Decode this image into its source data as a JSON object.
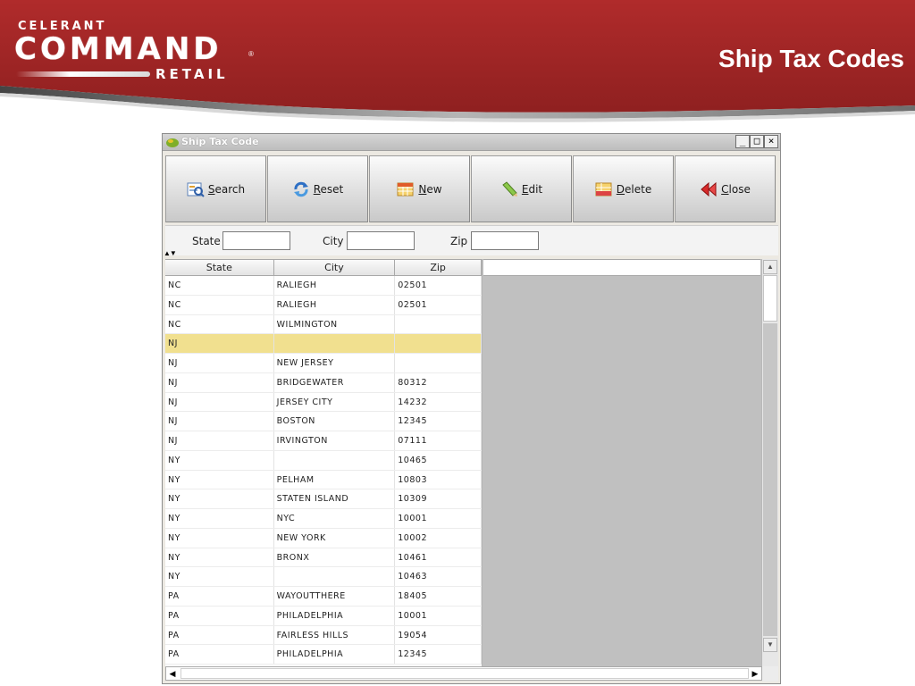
{
  "slide": {
    "title": "Ship Tax Codes",
    "logo_top": "CELERANT",
    "logo_main": "COMMAND",
    "logo_bottom": "RETAIL"
  },
  "window": {
    "title": "Ship Tax Code",
    "controls": {
      "minimize": "_",
      "maximize": "□",
      "close": "×"
    }
  },
  "toolbar": {
    "search_label": "Search",
    "reset_label": "Reset",
    "new_label": "New",
    "edit_label": "Edit",
    "delete_label": "Delete",
    "close_label": "Close"
  },
  "filters": {
    "state_label": "State",
    "city_label": "City",
    "zip_label": "Zip",
    "state_value": "",
    "city_value": "",
    "zip_value": ""
  },
  "grid": {
    "columns": [
      "State",
      "City",
      "Zip"
    ],
    "rows": [
      [
        "NC",
        "RALIEGH",
        "02501"
      ],
      [
        "NC",
        "RALIEGH",
        "02501"
      ],
      [
        "NC",
        "WILMINGTON",
        ""
      ],
      [
        "NJ",
        "",
        ""
      ],
      [
        "NJ",
        "NEW JERSEY",
        ""
      ],
      [
        "NJ",
        "BRIDGEWATER",
        "80312"
      ],
      [
        "NJ",
        "JERSEY CITY",
        "14232"
      ],
      [
        "NJ",
        "BOSTON",
        "12345"
      ],
      [
        "NJ",
        "IRVINGTON",
        "07111"
      ],
      [
        "NY",
        "",
        "10465"
      ],
      [
        "NY",
        "PELHAM",
        "10803"
      ],
      [
        "NY",
        "STATEN ISLAND",
        "10309"
      ],
      [
        "NY",
        "NYC",
        "10001"
      ],
      [
        "NY",
        "NEW YORK",
        "10002"
      ],
      [
        "NY",
        "BRONX",
        "10461"
      ],
      [
        "NY",
        "",
        "10463"
      ],
      [
        "PA",
        "WAYOUTTHERE",
        "18405"
      ],
      [
        "PA",
        "PHILADELPHIA",
        "10001"
      ],
      [
        "PA",
        "FAIRLESS HILLS",
        "19054"
      ],
      [
        "PA",
        "PHILADELPHIA",
        "12345"
      ]
    ],
    "selected_row": 3,
    "colors": {
      "selected": "#f1e08f",
      "banner": "#a52a2a"
    }
  }
}
